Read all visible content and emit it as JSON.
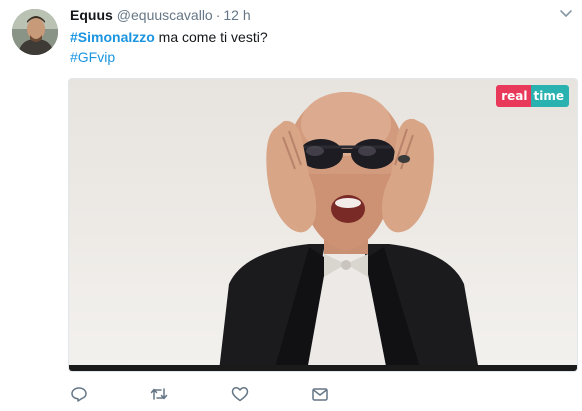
{
  "tweet": {
    "author_name": "Equus",
    "author_handle": "@equuscavallo",
    "separator": "·",
    "time": "12 h",
    "hashtag1": "#SimonaIzzo",
    "text_after": " ma come ti vesti?",
    "hashtag2": "#GFvip"
  },
  "media": {
    "logo_part1": "real",
    "logo_part2": "time"
  },
  "colors": {
    "link": "#1b95e0",
    "secondary": "#657786",
    "logo_pink": "#e8395a",
    "logo_teal": "#2ab2b0"
  },
  "icons": {
    "reply": "reply-icon",
    "retweet": "retweet-icon",
    "like": "heart-icon",
    "dm": "envelope-icon",
    "menu": "chevron-down-icon"
  }
}
